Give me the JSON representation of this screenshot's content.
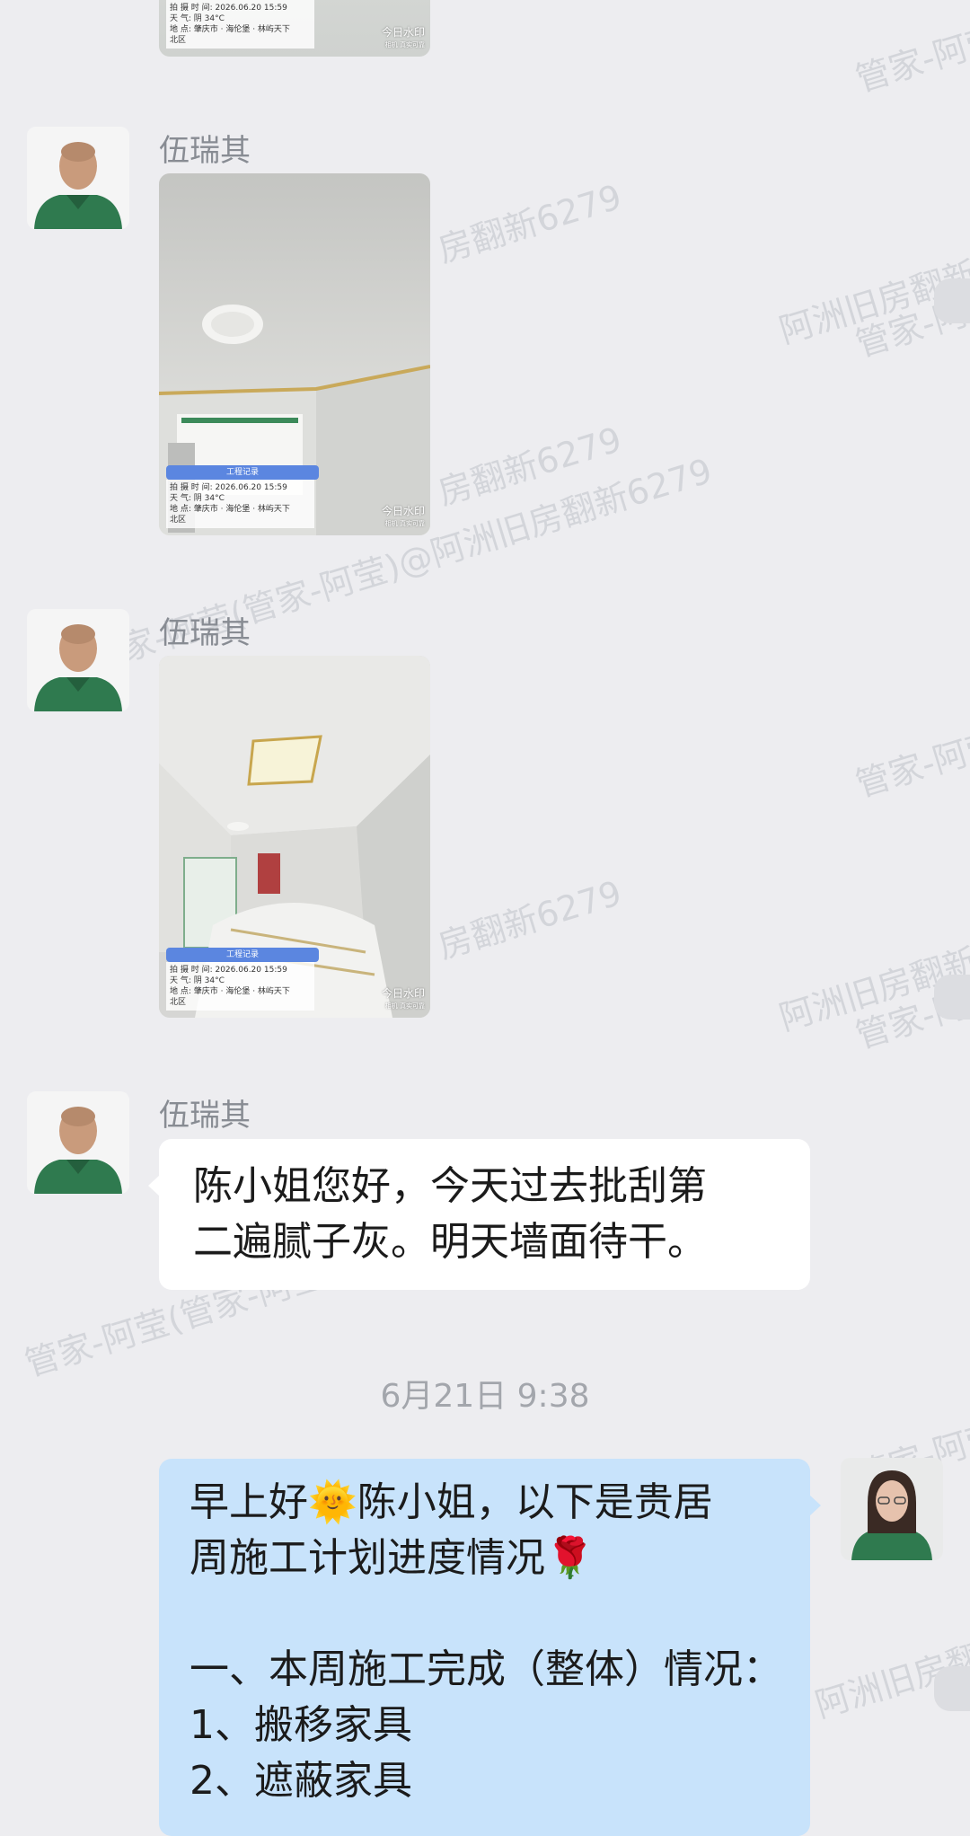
{
  "watermark": {
    "company": "管家-阿莹",
    "agency": "房翻新6279",
    "full": "管家-阿莹(管家-阿莹)@阿洲旧房翻新6279",
    "partial": "阿洲旧房翻新6",
    "partial2": "管家-阿莹(管家-阿莹)@"
  },
  "photo_watermark": {
    "label": "工程记录",
    "time_row": "拍 摄 时 间: 2026.06.20 15:59",
    "weather_row": "天      气: 阴 34°C",
    "place_row": "地      点: 肇庆市 · 海伦堡 · 林屿天下",
    "place_row2": "北区",
    "corner": "今日水印",
    "corner_sub": "相机 真实可靠"
  },
  "messages": [
    {
      "sender": "伍瑞其",
      "type": "photo",
      "scene": "ceiling-lamp"
    },
    {
      "sender": "伍瑞其",
      "type": "photo",
      "scene": "room-panel"
    },
    {
      "sender": "伍瑞其",
      "type": "text",
      "lines": [
        "陈小姐您好，今天过去批刮第",
        "二遍腻子灰。明天墙面待干。"
      ]
    }
  ],
  "time_separator": "6月21日  9:38",
  "outgoing": {
    "lines": [
      "早上好🌞陈小姐，以下是贵居",
      "周施工计划进度情况🌹",
      "",
      "一、本周施工完成（整体）情况：",
      "1、搬移家具",
      "2、遮蔽家具"
    ]
  },
  "colors": {
    "background": "#ededf0",
    "incoming_bubble": "#ffffff",
    "outgoing_bubble": "#c8e3fb",
    "sender_text": "#888c93",
    "uniform_green": "#2f7a4f"
  }
}
